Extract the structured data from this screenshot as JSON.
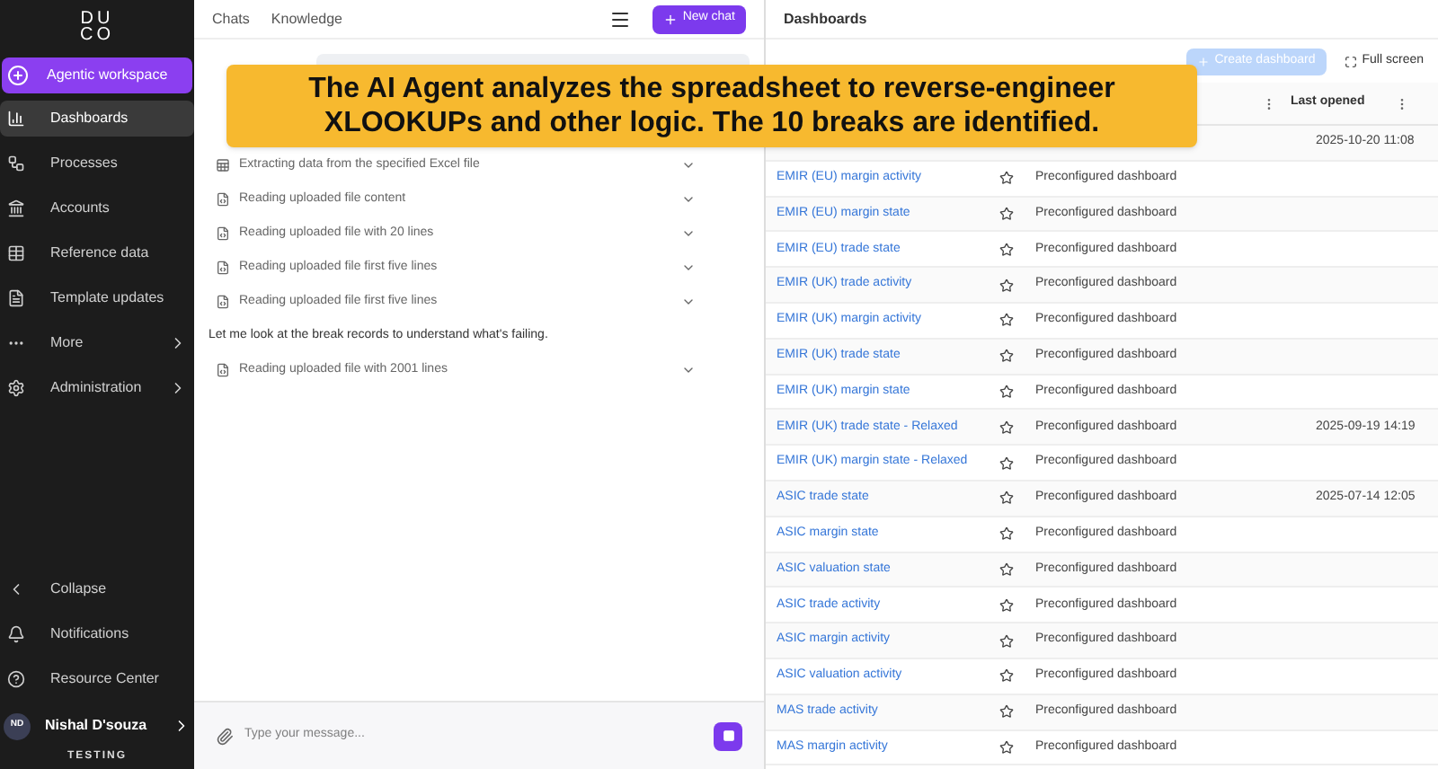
{
  "sidebar": {
    "logo": [
      "DU",
      "CO"
    ],
    "workspace_button": "Agentic workspace",
    "items": [
      {
        "label": "Dashboards",
        "selected": true,
        "submenu": false
      },
      {
        "label": "Processes",
        "selected": false,
        "submenu": false
      },
      {
        "label": "Accounts",
        "selected": false,
        "submenu": false
      },
      {
        "label": "Reference data",
        "selected": false,
        "submenu": false
      },
      {
        "label": "Template updates",
        "selected": false,
        "submenu": false
      },
      {
        "label": "More",
        "selected": false,
        "submenu": true
      },
      {
        "label": "Administration",
        "selected": false,
        "submenu": true
      }
    ],
    "bottom": [
      "Collapse",
      "Notifications",
      "Resource Center"
    ],
    "user": {
      "initials": "ND",
      "name": "Nishal D'souza"
    },
    "environment": "TESTING"
  },
  "chat": {
    "tabs": [
      {
        "label": "Chats",
        "selected": false
      },
      {
        "label": "Knowledge",
        "selected": false
      }
    ],
    "new_chat": "New chat",
    "steps": [
      {
        "kind": "excel",
        "text": "Extracting data from the specified Excel file"
      },
      {
        "kind": "file",
        "text": "Reading uploaded file content"
      },
      {
        "kind": "file",
        "text": "Reading uploaded file with 20 lines"
      },
      {
        "kind": "file",
        "text": "Reading uploaded file first five lines"
      },
      {
        "kind": "file",
        "text": "Reading uploaded file first five lines"
      },
      {
        "kind": "message",
        "text": "Let me look at the break records to understand what's failing."
      },
      {
        "kind": "file",
        "text": "Reading uploaded file with 2001 lines"
      }
    ],
    "input": {
      "placeholder": "Type your message..."
    }
  },
  "dashboards": {
    "title": "Dashboards",
    "create_button": {
      "label": "Create dashboard",
      "disabled": true
    },
    "full_screen": "Full screen",
    "columns": {
      "last_opened": "Last opened"
    },
    "rows": [
      {
        "last_opened": "2025-10-20 11:08"
      },
      {
        "name": "EMIR (EU) margin activity",
        "starred": false,
        "description": "Preconfigured dashboard"
      },
      {
        "name": "EMIR (EU) margin state",
        "starred": false,
        "description": "Preconfigured dashboard"
      },
      {
        "name": "EMIR (EU) trade state",
        "starred": false,
        "description": "Preconfigured dashboard"
      },
      {
        "name": "EMIR (UK) trade activity",
        "starred": false,
        "description": "Preconfigured dashboard"
      },
      {
        "name": "EMIR (UK) margin activity",
        "starred": false,
        "description": "Preconfigured dashboard"
      },
      {
        "name": "EMIR (UK) trade state",
        "starred": false,
        "description": "Preconfigured dashboard"
      },
      {
        "name": "EMIR (UK) margin state",
        "starred": false,
        "description": "Preconfigured dashboard"
      },
      {
        "name": "EMIR (UK) trade state - Relaxed",
        "starred": false,
        "description": "Preconfigured dashboard",
        "last_opened": "2025-09-19 14:19"
      },
      {
        "name": "EMIR (UK) margin state - Relaxed",
        "starred": false,
        "description": "Preconfigured dashboard"
      },
      {
        "name": "ASIC trade state",
        "starred": false,
        "description": "Preconfigured dashboard",
        "last_opened": "2025-07-14 12:05"
      },
      {
        "name": "ASIC margin state",
        "starred": false,
        "description": "Preconfigured dashboard"
      },
      {
        "name": "ASIC valuation state",
        "starred": false,
        "description": "Preconfigured dashboard"
      },
      {
        "name": "ASIC trade activity",
        "starred": false,
        "description": "Preconfigured dashboard"
      },
      {
        "name": "ASIC margin activity",
        "starred": false,
        "description": "Preconfigured dashboard"
      },
      {
        "name": "ASIC valuation activity",
        "starred": false,
        "description": "Preconfigured dashboard"
      },
      {
        "name": "MAS trade activity",
        "starred": false,
        "description": "Preconfigured dashboard"
      },
      {
        "name": "MAS margin activity",
        "starred": false,
        "description": "Preconfigured dashboard"
      }
    ]
  },
  "caption": "The AI Agent analyzes the spreadsheet to reverse-engineer XLOOKUPs and other logic. The 10 breaks are identified."
}
